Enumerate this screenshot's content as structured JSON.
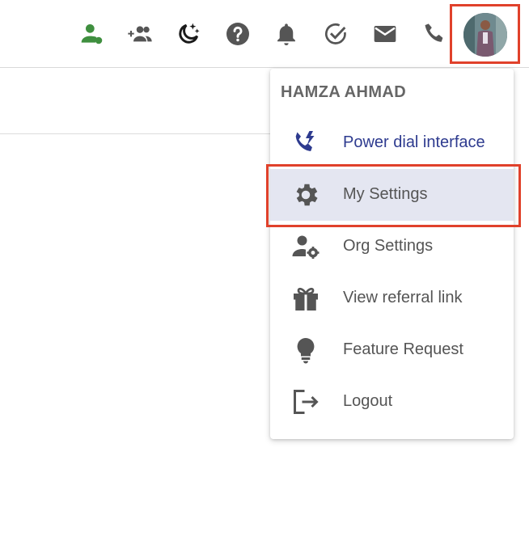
{
  "colors": {
    "accent_blue": "#2e3b8f",
    "icon_grey": "#555555",
    "status_green": "#3f8f3f",
    "highlight_red": "#e0412b",
    "selected_bg": "#e4e6f1"
  },
  "toolbar": {
    "icons": [
      {
        "name": "user-status-icon"
      },
      {
        "name": "add-group-icon"
      },
      {
        "name": "dnd-moon-icon"
      },
      {
        "name": "help-icon"
      },
      {
        "name": "bell-icon"
      },
      {
        "name": "task-check-icon"
      },
      {
        "name": "mail-icon"
      },
      {
        "name": "phone-icon"
      }
    ],
    "avatar": {
      "name": "user-avatar"
    }
  },
  "menu": {
    "header": "HAMZA AHMAD",
    "items": [
      {
        "label": "Power dial interface",
        "icon": "power-dial-icon"
      },
      {
        "label": "My Settings",
        "icon": "gear-icon",
        "selected": true
      },
      {
        "label": "Org Settings",
        "icon": "org-settings-icon"
      },
      {
        "label": "View referral link",
        "icon": "gift-icon"
      },
      {
        "label": "Feature Request",
        "icon": "lightbulb-icon"
      },
      {
        "label": "Logout",
        "icon": "logout-icon"
      }
    ]
  }
}
